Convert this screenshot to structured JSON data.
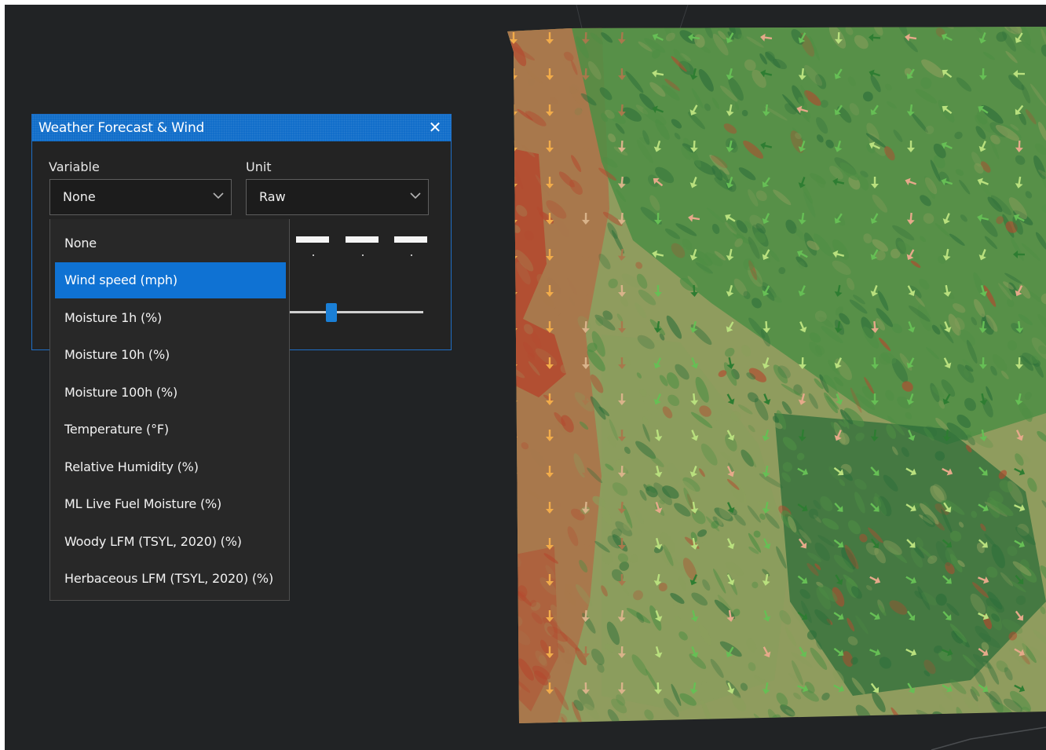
{
  "dialog": {
    "title": "Weather Forecast & Wind",
    "close_glyph": "✕",
    "variable": {
      "label": "Variable",
      "selected": "None"
    },
    "unit": {
      "label": "Unit",
      "selected": "Raw"
    }
  },
  "dropdown": {
    "options": [
      "None",
      "Wind speed (mph)",
      "Moisture 1h (%)",
      "Moisture 10h (%)",
      "Moisture 100h (%)",
      "Temperature (°F)",
      "Relative Humidity (%)",
      "ML Live Fuel Moisture (%)",
      "Woody LFM (TSYL, 2020) (%)",
      "Herbaceous LFM (TSYL, 2020) (%)"
    ],
    "highlighted_index": 1
  },
  "icons": {
    "close": "close-icon",
    "combo_chevron": "chevron-down-icon",
    "wind_arrow": "wind-arrow-icon"
  },
  "colors": {
    "accent": "#0f72d3",
    "dialog_bg": "#232323",
    "app_bg": "#212325",
    "raster_hot": "#b4482e",
    "raster_warm": "#a8784c",
    "raster_neutral": "#8a9e5c",
    "raster_green": "#4e8e44",
    "raster_dark_green": "#2c6e3a",
    "arrow_orange": "#f2ac4a",
    "arrow_light_green": "#b9e07e",
    "arrow_green": "#66bf55",
    "arrow_dark_green": "#2e7d32"
  }
}
